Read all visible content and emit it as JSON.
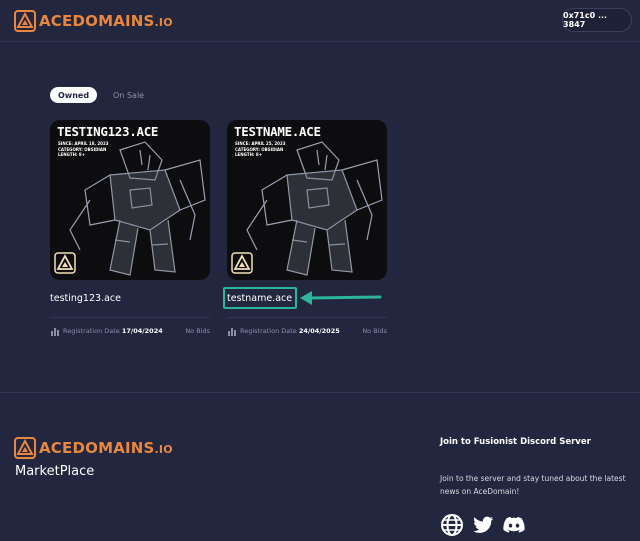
{
  "header": {
    "logo_text": "AceDomains",
    "logo_suffix": ".io",
    "wallet_label": "0x71c0 ... 3847"
  },
  "tabs": [
    {
      "label": "Owned",
      "active": true
    },
    {
      "label": "On Sale",
      "active": false
    }
  ],
  "cards": [
    {
      "image_title": "TESTING123.ACE",
      "image_meta": [
        "SINCE: APRIL 18, 2023",
        "CATEGORY: OBSIDIAN",
        "LENGTH: 8+"
      ],
      "name": "testing123.ace",
      "date_label": "Registration Date",
      "date_value": "17/04/2024",
      "bids": "No Bids"
    },
    {
      "image_title": "TESTNAME.ACE",
      "image_meta": [
        "SINCE: APRIL 25, 2023",
        "CATEGORY: OBSIDIAN",
        "LENGTH: 8+"
      ],
      "name": "testname.ace",
      "date_label": "Registration Date",
      "date_value": "24/04/2025",
      "bids": "No Bids"
    }
  ],
  "footer": {
    "logo_text": "AceDomains",
    "logo_suffix": ".io",
    "marketplace_label": "MarketPlace",
    "discord_title": "Join to Fusionist Discord Server",
    "discord_desc": "Join to the server and stay tuned about the latest news on AceDomain!",
    "socials": [
      "globe-icon",
      "twitter-icon",
      "discord-icon"
    ]
  },
  "colors": {
    "background": "#22263f",
    "brand": "#e9873f",
    "annotation": "#2bb59a",
    "muted": "#8b8fa8"
  }
}
